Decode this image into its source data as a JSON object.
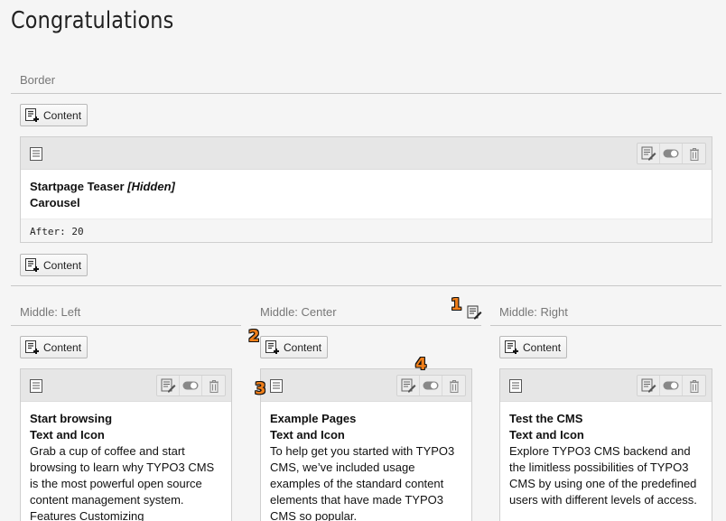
{
  "page": {
    "title": "Congratulations"
  },
  "border": {
    "label": "Border",
    "add_top": "Content",
    "add_bottom": "Content",
    "card": {
      "title": "Startpage Teaser",
      "hidden_tag": "[Hidden]",
      "subtitle": "Carousel",
      "footer": "After: 20"
    }
  },
  "columns": [
    {
      "label": "Middle: Left",
      "add_label": "Content",
      "card": {
        "title": "Start browsing",
        "subtitle": "Text and Icon",
        "text": "Grab a cup of coffee and start browsing to learn why TYPO3 CMS is the most powerful open source content management system. Features Customizing"
      }
    },
    {
      "label": "Middle: Center",
      "add_label": "Content",
      "card": {
        "title": "Example Pages",
        "subtitle": "Text and Icon",
        "text": "To help get you started with TYPO3 CMS, we’ve included usage examples of the standard content elements that have made TYPO3 CMS so popular."
      }
    },
    {
      "label": "Middle: Right",
      "add_label": "Content",
      "card": {
        "title": "Test the CMS",
        "subtitle": "Text and Icon",
        "text": "Explore TYPO3 CMS backend and the limitless possibilities of TYPO3 CMS by using one of the predefined users with different levels of access."
      }
    }
  ],
  "markers": [
    "1",
    "2",
    "3",
    "4"
  ],
  "icons": {
    "add": "add-content-icon",
    "doc": "content-element-icon",
    "edit": "edit-icon",
    "toggle": "toggle-icon",
    "delete": "trash-icon"
  }
}
